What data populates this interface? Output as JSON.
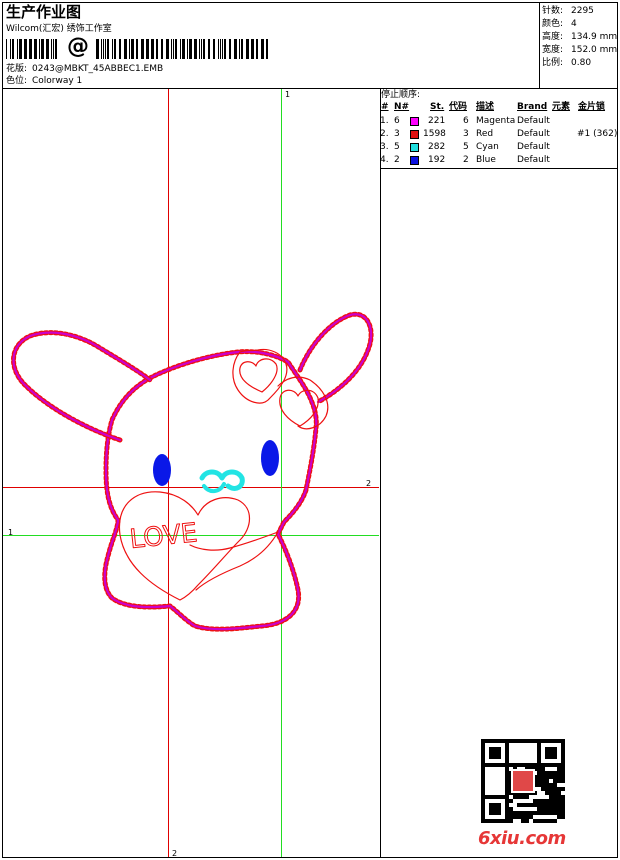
{
  "header": {
    "title": "生产作业图",
    "company": "Wilcom(汇宏) 绣饰工作室",
    "barcode_symbol": "@",
    "design_label": "花版:",
    "design_value": "0243@MBKT_45ABBEC1.EMB",
    "colorway_label": "色位:",
    "colorway_value": "Colorway 1"
  },
  "stats": [
    {
      "label": "针数:",
      "value": "2295"
    },
    {
      "label": "颜色:",
      "value": "4"
    },
    {
      "label": "高度:",
      "value": "134.9 mm"
    },
    {
      "label": "宽度:",
      "value": "152.0 mm"
    },
    {
      "label": "比例:",
      "value": "0.80"
    }
  ],
  "stop_sequence": {
    "heading": "停止顺序:",
    "columns": [
      "#",
      "N#",
      "St.",
      "代码",
      "描述",
      "Brand",
      "元素",
      "金片锁"
    ],
    "rows": [
      {
        "idx": "1.",
        "n": "6",
        "color": "#ff00ff",
        "st": "221",
        "code": "6",
        "desc": "Magenta",
        "brand": "Default",
        "element": "",
        "sequin": ""
      },
      {
        "idx": "2.",
        "n": "3",
        "color": "#e01010",
        "st": "1598",
        "code": "3",
        "desc": "Red",
        "brand": "Default",
        "element": "",
        "sequin": "#1 (362)"
      },
      {
        "idx": "3.",
        "n": "5",
        "color": "#22e0e0",
        "st": "282",
        "code": "5",
        "desc": "Cyan",
        "brand": "Default",
        "element": "",
        "sequin": ""
      },
      {
        "idx": "4.",
        "n": "2",
        "color": "#0a10e0",
        "st": "192",
        "code": "2",
        "desc": "Blue",
        "brand": "Default",
        "element": "",
        "sequin": ""
      }
    ]
  },
  "guides": {
    "red_label": "2",
    "green_label": "1"
  },
  "design": {
    "text": "LOVE",
    "colors": {
      "outline": "#ee1111",
      "satin": "#cc00cc",
      "eyes": "#0a18e8",
      "nose": "#22e4e4",
      "guide_red": "#e00000",
      "guide_green": "#22dd22"
    }
  },
  "watermark": "6xiu.com"
}
